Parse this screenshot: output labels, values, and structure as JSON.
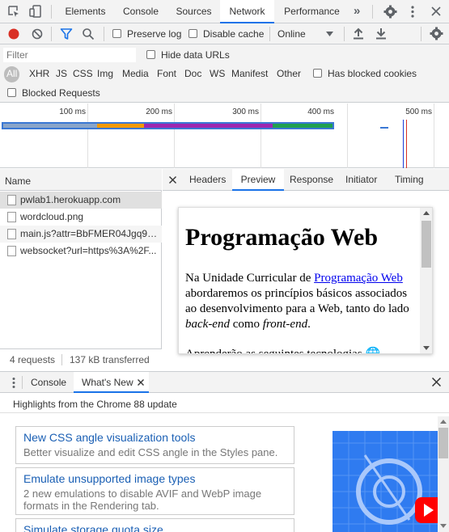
{
  "main_tabs": [
    "Elements",
    "Console",
    "Sources",
    "Network",
    "Performance"
  ],
  "active_tab": "Network",
  "toolbar": {
    "preserve_log": "Preserve log",
    "disable_cache": "Disable cache",
    "throttle": "Online"
  },
  "filter": {
    "placeholder": "Filter",
    "hide_data_urls": "Hide data URLs",
    "types": [
      "All",
      "XHR",
      "JS",
      "CSS",
      "Img",
      "Media",
      "Font",
      "Doc",
      "WS",
      "Manifest",
      "Other"
    ],
    "has_blocked_cookies": "Has blocked cookies",
    "blocked_requests": "Blocked Requests"
  },
  "overview": {
    "ticks": [
      "100 ms",
      "200 ms",
      "300 ms",
      "400 ms",
      "500 ms"
    ]
  },
  "requests": {
    "header": "Name",
    "rows": [
      "pwlab1.herokuapp.com",
      "wordcloud.png",
      "main.js?attr=BbFMER04Jgq9A...",
      "websocket?url=https%3A%2F..."
    ],
    "summary_count": "4 requests",
    "summary_transferred": "137 kB transferred"
  },
  "detail_tabs": [
    "Headers",
    "Preview",
    "Response",
    "Initiator",
    "Timing"
  ],
  "active_detail_tab": "Preview",
  "preview": {
    "heading": "Programação Web",
    "para_before": "Na Unidade Curricular de ",
    "link": "Programação Web",
    "para_after": " abordaremos os princípios básicos associados ao desenvolvimento para a Web, tanto do lado ",
    "em1": "back-end",
    "mid": " como ",
    "em2": "front-end",
    "end": ".",
    "next": "Aprenderão as seguintes tecnologias"
  },
  "drawer": {
    "tabs": [
      "Console",
      "What's New"
    ],
    "active": "What's New",
    "highlights": "Highlights from the Chrome 88 update",
    "cards": [
      {
        "title": "New CSS angle visualization tools",
        "desc": "Better visualize and edit CSS angle in the Styles pane."
      },
      {
        "title": "Emulate unsupported image types",
        "desc": "2 new emulations to disable AVIF and WebP image formats in the Rendering tab."
      },
      {
        "title": "Simulate storage quota size",
        "desc": ""
      }
    ]
  },
  "colors": {
    "accent": "#1a73e8",
    "record": "#d93025"
  }
}
